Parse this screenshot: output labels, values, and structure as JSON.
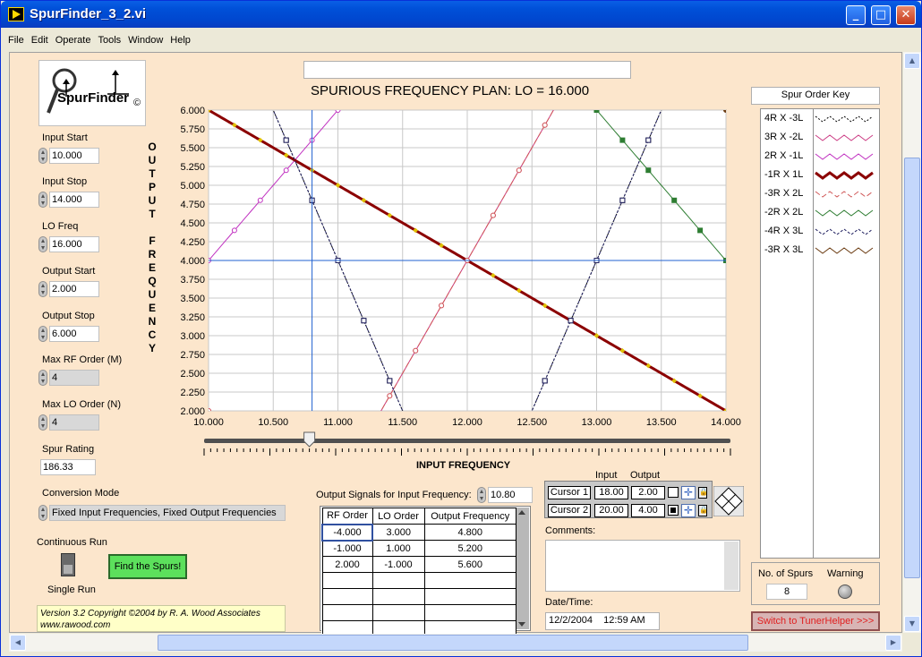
{
  "window": {
    "title": "SpurFinder_3_2.vi"
  },
  "menu": [
    "File",
    "Edit",
    "Operate",
    "Tools",
    "Window",
    "Help"
  ],
  "logo": {
    "text": "SpurFinder",
    "mark": "©"
  },
  "controls": {
    "input_start": {
      "label": "Input Start",
      "value": "10.000"
    },
    "input_stop": {
      "label": "Input Stop",
      "value": "14.000"
    },
    "lo_freq": {
      "label": "LO Freq",
      "value": "16.000"
    },
    "output_start": {
      "label": "Output Start",
      "value": "2.000"
    },
    "output_stop": {
      "label": "Output Stop",
      "value": "6.000"
    },
    "max_rf": {
      "label": "Max RF Order (M)",
      "value": "4"
    },
    "max_lo": {
      "label": "Max LO Order (N)",
      "value": "4"
    },
    "spur_rating": {
      "label": "Spur Rating",
      "value": "186.33"
    },
    "conversion_mode": {
      "label": "Conversion Mode",
      "value": "Fixed Input Frequencies, Fixed Output Frequencies"
    },
    "continuous_run": "Continuous Run",
    "single_run": "Single Run",
    "find_button": "Find the Spurs!"
  },
  "version_text": {
    "line1": "Version 3.2 Copyright ©2004 by R. A. Wood Associates",
    "line2": "www.rawood.com"
  },
  "chart_data": {
    "type": "line",
    "title": "SPURIOUS FREQUENCY PLAN: LO = 16.000",
    "xlabel": "INPUT FREQUENCY",
    "ylabel": "OUTPUT FREQUENCY",
    "xlim": [
      10.0,
      14.0
    ],
    "ylim": [
      2.0,
      6.0
    ],
    "xticks": [
      "10.000",
      "10.500",
      "11.000",
      "11.500",
      "12.000",
      "12.500",
      "13.000",
      "13.500",
      "14.000"
    ],
    "yticks": [
      "6.000",
      "5.750",
      "5.500",
      "5.250",
      "5.000",
      "4.750",
      "4.500",
      "4.250",
      "4.000",
      "3.750",
      "3.500",
      "3.250",
      "3.000",
      "2.750",
      "2.500",
      "2.250",
      "2.000"
    ],
    "grid": true,
    "cursors": [
      {
        "x": 10.8,
        "y": 2.0
      },
      {
        "x": 20.0,
        "y": 4.0
      }
    ],
    "series": [
      {
        "name": "4R X -3L",
        "color": "#000000",
        "dash": "2,2",
        "marker": "square-open",
        "m": 4,
        "n": -3
      },
      {
        "name": "3R X -2L",
        "color": "#cc3c84",
        "dash": "",
        "marker": "circle-open",
        "m": 3,
        "n": -2
      },
      {
        "name": "2R X -1L",
        "color": "#c030c0",
        "dash": "",
        "marker": "circle-open",
        "m": 2,
        "n": -1
      },
      {
        "name": "-1R X 1L",
        "color": "#8b0000",
        "dash": "",
        "marker": "diamond",
        "m": -1,
        "n": 1
      },
      {
        "name": "-3R X 2L",
        "color": "#d05858",
        "dash": "6,3",
        "marker": "circle-open",
        "m": -3,
        "n": 2
      },
      {
        "name": "-2R X 2L",
        "color": "#2e7d32",
        "dash": "",
        "marker": "square",
        "m": -2,
        "n": 2
      },
      {
        "name": "-4R X 3L",
        "color": "#202060",
        "dash": "3,2",
        "marker": "square-open",
        "m": -4,
        "n": 3
      },
      {
        "name": "-3R X 3L",
        "color": "#6a3a10",
        "dash": "",
        "marker": "circle",
        "m": -3,
        "n": 3
      }
    ]
  },
  "output_signals": {
    "label": "Output Signals for Input Frequency:",
    "input_value": "10.80",
    "headers": [
      "RF Order",
      "LO Order",
      "Output Frequency"
    ],
    "rows": [
      [
        "-4.000",
        "3.000",
        "4.800"
      ],
      [
        "-1.000",
        "1.000",
        "5.200"
      ],
      [
        "2.000",
        "-1.000",
        "5.600"
      ]
    ]
  },
  "cursor_panel": {
    "header_input": "Input",
    "header_output": "Output",
    "rows": [
      {
        "name": "Cursor 1",
        "input": "18.00",
        "output": "2.00"
      },
      {
        "name": "Cursor 2",
        "input": "20.00",
        "output": "4.00"
      }
    ]
  },
  "comments": {
    "label": "Comments:",
    "value": ""
  },
  "datetime": {
    "label": "Date/Time:",
    "value": "12/2/2004    12:59 AM"
  },
  "spur_key_title": "Spur Order Key",
  "spurs_count": {
    "label": "No. of Spurs",
    "value": "8"
  },
  "warning_label": "Warning",
  "switch_button": "Switch to TunerHelper >>>"
}
